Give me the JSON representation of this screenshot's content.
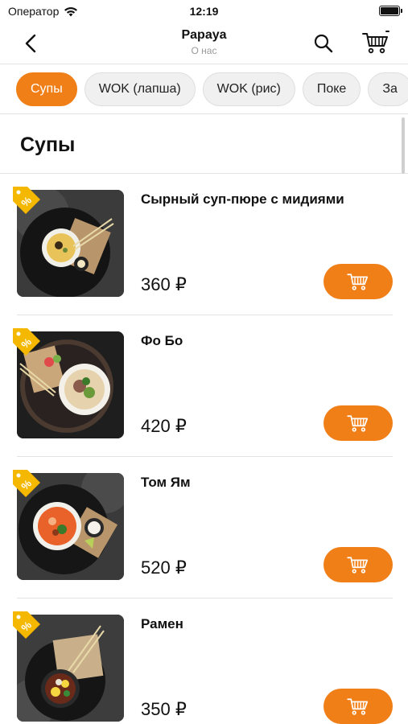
{
  "status_bar": {
    "carrier": "Оператор",
    "time": "12:19"
  },
  "nav": {
    "title": "Papaya",
    "subtitle": "О нас"
  },
  "categories": [
    {
      "label": "Супы",
      "active": true
    },
    {
      "label": "WOK (лапша)",
      "active": false
    },
    {
      "label": "WOK (рис)",
      "active": false
    },
    {
      "label": "Поке",
      "active": false
    },
    {
      "label": "За",
      "active": false
    }
  ],
  "section": {
    "title": "Супы"
  },
  "products": [
    {
      "name": "Сырный суп-пюре с мидиями",
      "price": "360 ₽"
    },
    {
      "name": "Фо Бо",
      "price": "420 ₽"
    },
    {
      "name": "Том Ям",
      "price": "520 ₽"
    },
    {
      "name": "Рамен",
      "price": "350 ₽"
    }
  ],
  "colors": {
    "accent": "#f07f17",
    "tag": "#f5b800"
  }
}
